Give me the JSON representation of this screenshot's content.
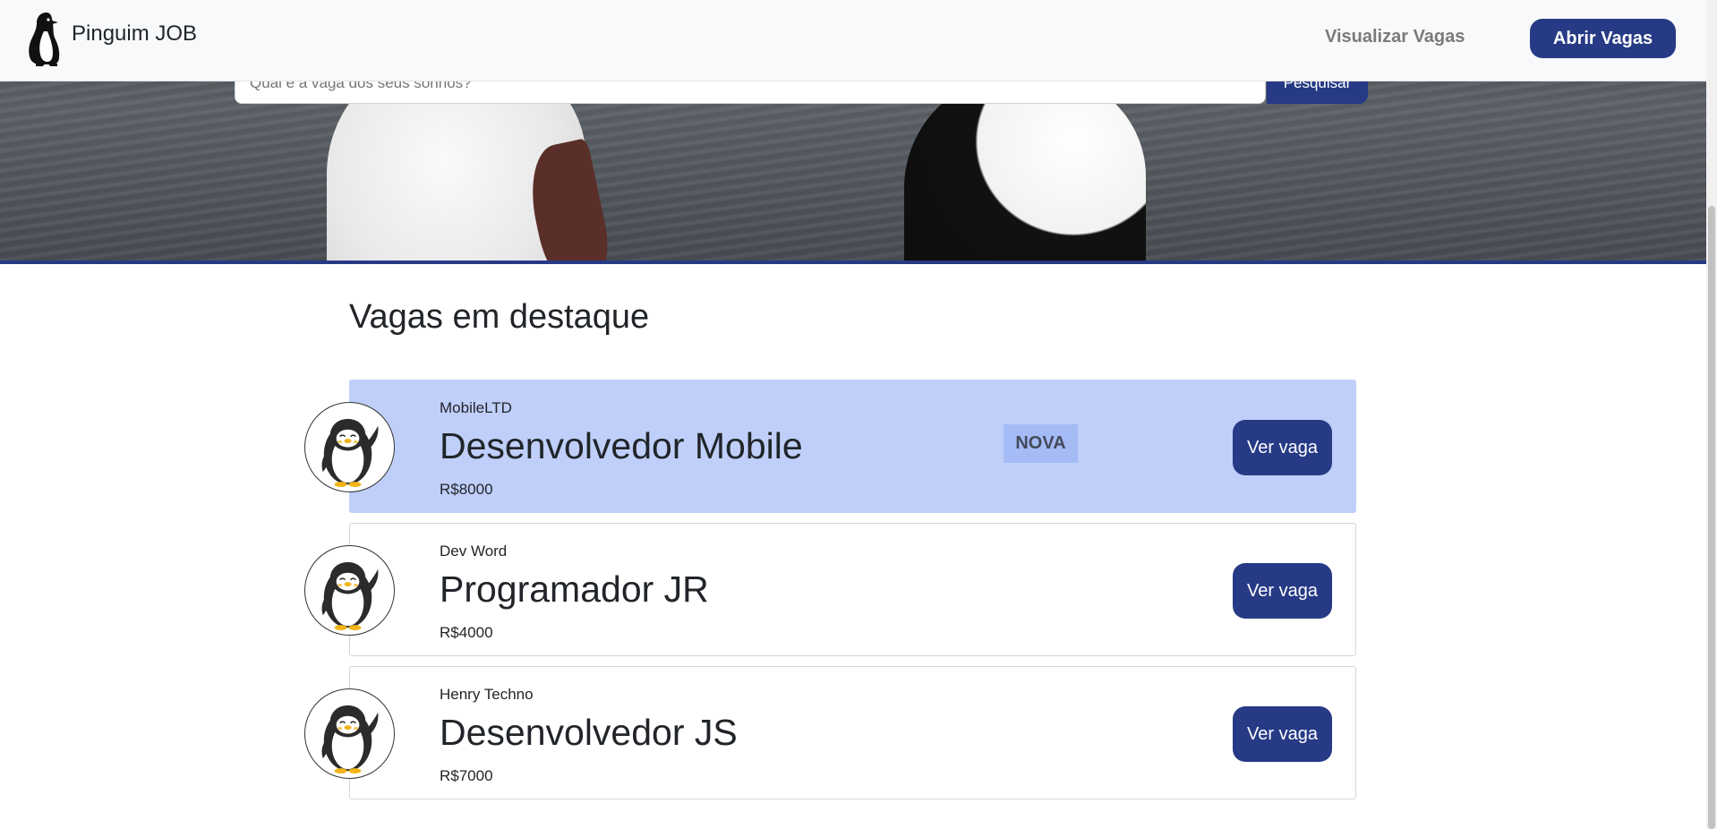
{
  "header": {
    "brand_name": "Pinguim JOB",
    "nav_view_jobs": "Visualizar Vagas",
    "open_jobs_button": "Abrir Vagas"
  },
  "search": {
    "placeholder": "Qual é a vaga dos seus sonhos?",
    "button_label": "Pesquisar"
  },
  "featured": {
    "title": "Vagas em destaque",
    "jobs": [
      {
        "company": "MobileLTD",
        "title": "Desenvolvedor Mobile",
        "salary": "R$8000",
        "badge": "NOVA",
        "highlighted": true,
        "button_label": "Ver vaga",
        "avatar_icon": "waving-penguin-icon"
      },
      {
        "company": "Dev Word",
        "title": "Programador JR",
        "salary": "R$4000",
        "badge": "",
        "highlighted": false,
        "button_label": "Ver vaga",
        "avatar_icon": "waving-penguin-icon"
      },
      {
        "company": "Henry Techno",
        "title": "Desenvolvedor JS",
        "salary": "R$7000",
        "badge": "",
        "highlighted": false,
        "button_label": "Ver vaga",
        "avatar_icon": "waving-penguin-icon"
      }
    ]
  },
  "colors": {
    "primary": "#263a85",
    "highlight_card": "#bfcffa",
    "badge": "#a4bbf6",
    "header_bg": "#f8f9fa"
  }
}
